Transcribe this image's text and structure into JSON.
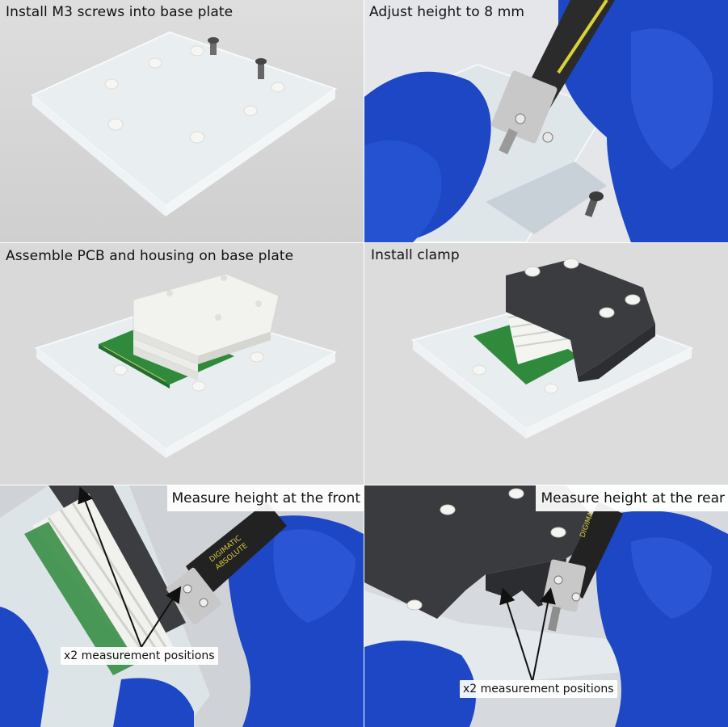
{
  "panels": [
    {
      "caption": "Install M3 screws into base plate"
    },
    {
      "caption": "Adjust height to 8 mm"
    },
    {
      "caption": "Assemble PCB and housing on base plate"
    },
    {
      "caption": "Install clamp"
    },
    {
      "caption": "Measure height at the front",
      "note": "x2 measurement positions"
    },
    {
      "caption": "Measure height at the rear",
      "note": "x2 measurement positions"
    }
  ],
  "caliper_brand": "DIGIMATIC",
  "caliper_model": "ABSOLUTE",
  "colors": {
    "glove": "#1d47c4",
    "pcb": "#2f8a3c",
    "housing_white": "#f2f2ef",
    "clamp_dark": "#3a3c3f",
    "acrylic": "#e6ecef",
    "background": "#dcdcdc"
  }
}
